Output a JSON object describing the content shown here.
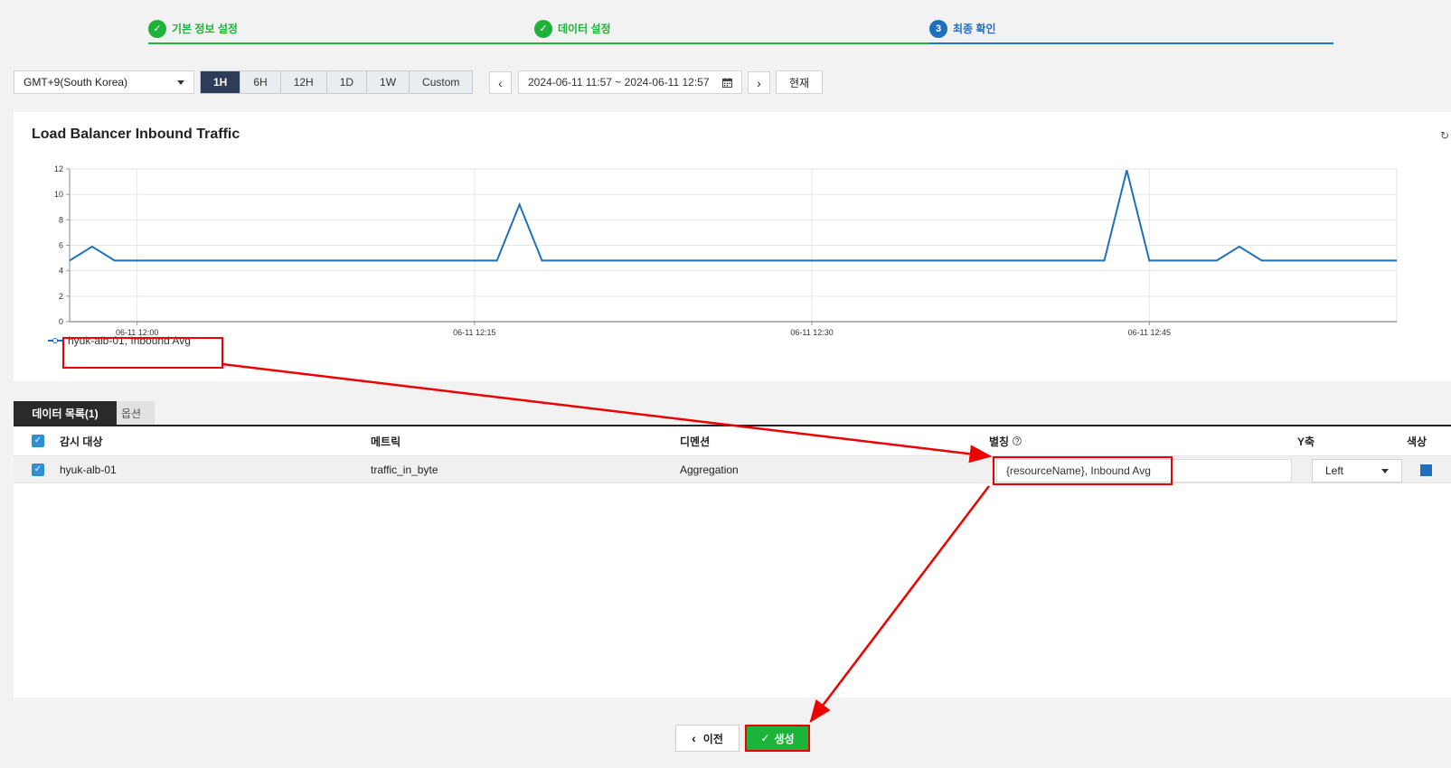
{
  "stepper": {
    "steps": [
      {
        "label": "기본 정보 설정",
        "state": "done",
        "num": "✓"
      },
      {
        "label": "데이터 설정",
        "state": "done",
        "num": "✓"
      },
      {
        "label": "최종 확인",
        "state": "active",
        "num": "3"
      }
    ]
  },
  "toolbar": {
    "timezone": "GMT+9(South Korea)",
    "ranges": [
      "1H",
      "6H",
      "12H",
      "1D",
      "1W",
      "Custom"
    ],
    "selected_range": "1H",
    "prev_icon": "‹",
    "next_icon": "›",
    "date_range": "2024-06-11 11:57 ~ 2024-06-11 12:57",
    "now_label": "현재"
  },
  "chart": {
    "title": "Load Balancer Inbound Traffic",
    "legend_label": "hyuk-alb-01, Inbound Avg"
  },
  "chart_data": {
    "type": "line",
    "title": "Load Balancer Inbound Traffic",
    "xlabel": "",
    "ylabel": "",
    "ylim": [
      0,
      12
    ],
    "yticks": [
      "0",
      "2",
      "4",
      "6",
      "8",
      "10",
      "12"
    ],
    "xticks": [
      "06-11 12:00",
      "06-11 12:15",
      "06-11 12:30",
      "06-11 12:45"
    ],
    "x_minutes_range": [
      -3,
      56
    ],
    "grid": true,
    "legend": "bottom-left",
    "series": [
      {
        "name": "hyuk-alb-01, Inbound Avg",
        "color": "#1f6fbf",
        "points": [
          [
            -3.0,
            4.8
          ],
          [
            -2.0,
            5.9
          ],
          [
            -1.0,
            4.8
          ],
          [
            16.0,
            4.8
          ],
          [
            17.0,
            9.2
          ],
          [
            18.0,
            4.8
          ],
          [
            43.0,
            4.8
          ],
          [
            44.0,
            11.9
          ],
          [
            45.0,
            4.8
          ],
          [
            48.0,
            4.8
          ],
          [
            49.0,
            5.9
          ],
          [
            50.0,
            4.8
          ],
          [
            56.0,
            4.8
          ]
        ]
      }
    ]
  },
  "tabs": {
    "data_list": "데이터 목록(1)",
    "options": "옵션"
  },
  "table": {
    "headers": {
      "target": "감시 대상",
      "metric": "메트릭",
      "dimension": "디멘션",
      "alias": "별칭",
      "yaxis": "Y축",
      "color": "색상"
    },
    "row": {
      "target": "hyuk-alb-01",
      "metric": "traffic_in_byte",
      "dimension": "Aggregation",
      "alias": "{resourceName}, Inbound Avg",
      "yaxis": "Left",
      "color": "#1f6fbf"
    }
  },
  "footer": {
    "prev_label": "이전",
    "create_label": "생성"
  },
  "colors": {
    "success": "#1fb23a",
    "active_step": "#1f6fbf",
    "annotation": "#ee0000",
    "range_selected": "#2f3c58"
  }
}
